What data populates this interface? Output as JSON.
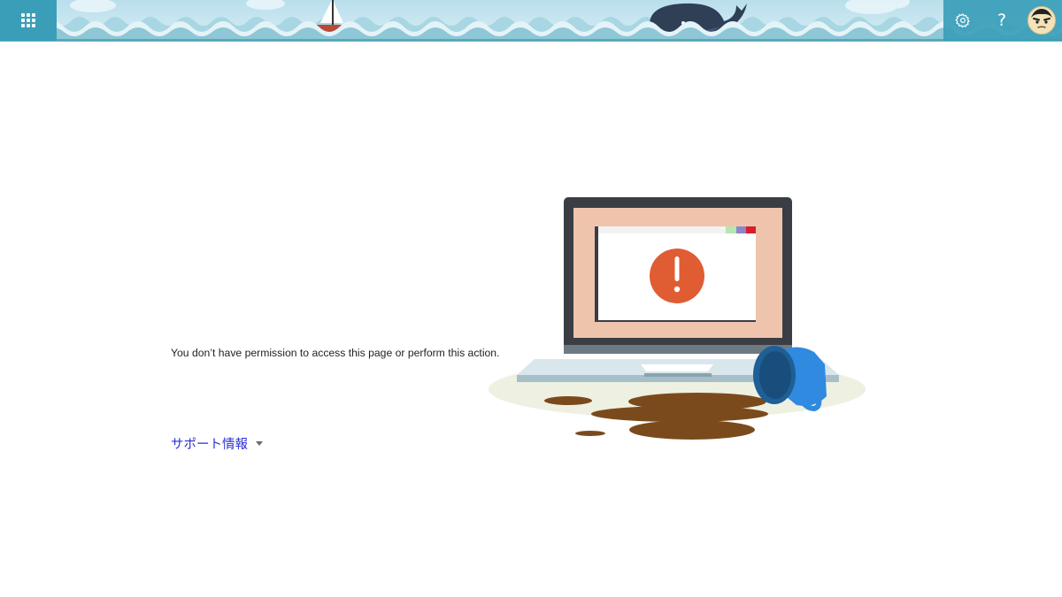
{
  "header": {
    "app_launcher_icon": "waffle-grid-icon",
    "settings_icon": "gear-icon",
    "help_icon": "question-mark-icon",
    "help_glyph": "?",
    "avatar_icon": "user-avatar-face-icon",
    "banner_theme": "ocean-waves-sailboat-whale",
    "colors": {
      "bar": "#3b9eb8",
      "sky": "#c4e3ee",
      "wave": "#7fc1d2",
      "wave_light": "#d9eef4"
    }
  },
  "main": {
    "message": "You don’t have permission to access this page or perform this action.",
    "support": {
      "label": "サポート情報",
      "caret_icon": "caret-down-icon"
    },
    "illustration": {
      "name": "laptop-error-spilled-coffee",
      "colors": {
        "screen": "#efc4ad",
        "alert": "#e05c33",
        "mug": "#1e5f96",
        "coffee": "#7a4a1d",
        "shadow": "#ebece0"
      }
    },
    "link_color": "#2b2fd6"
  }
}
